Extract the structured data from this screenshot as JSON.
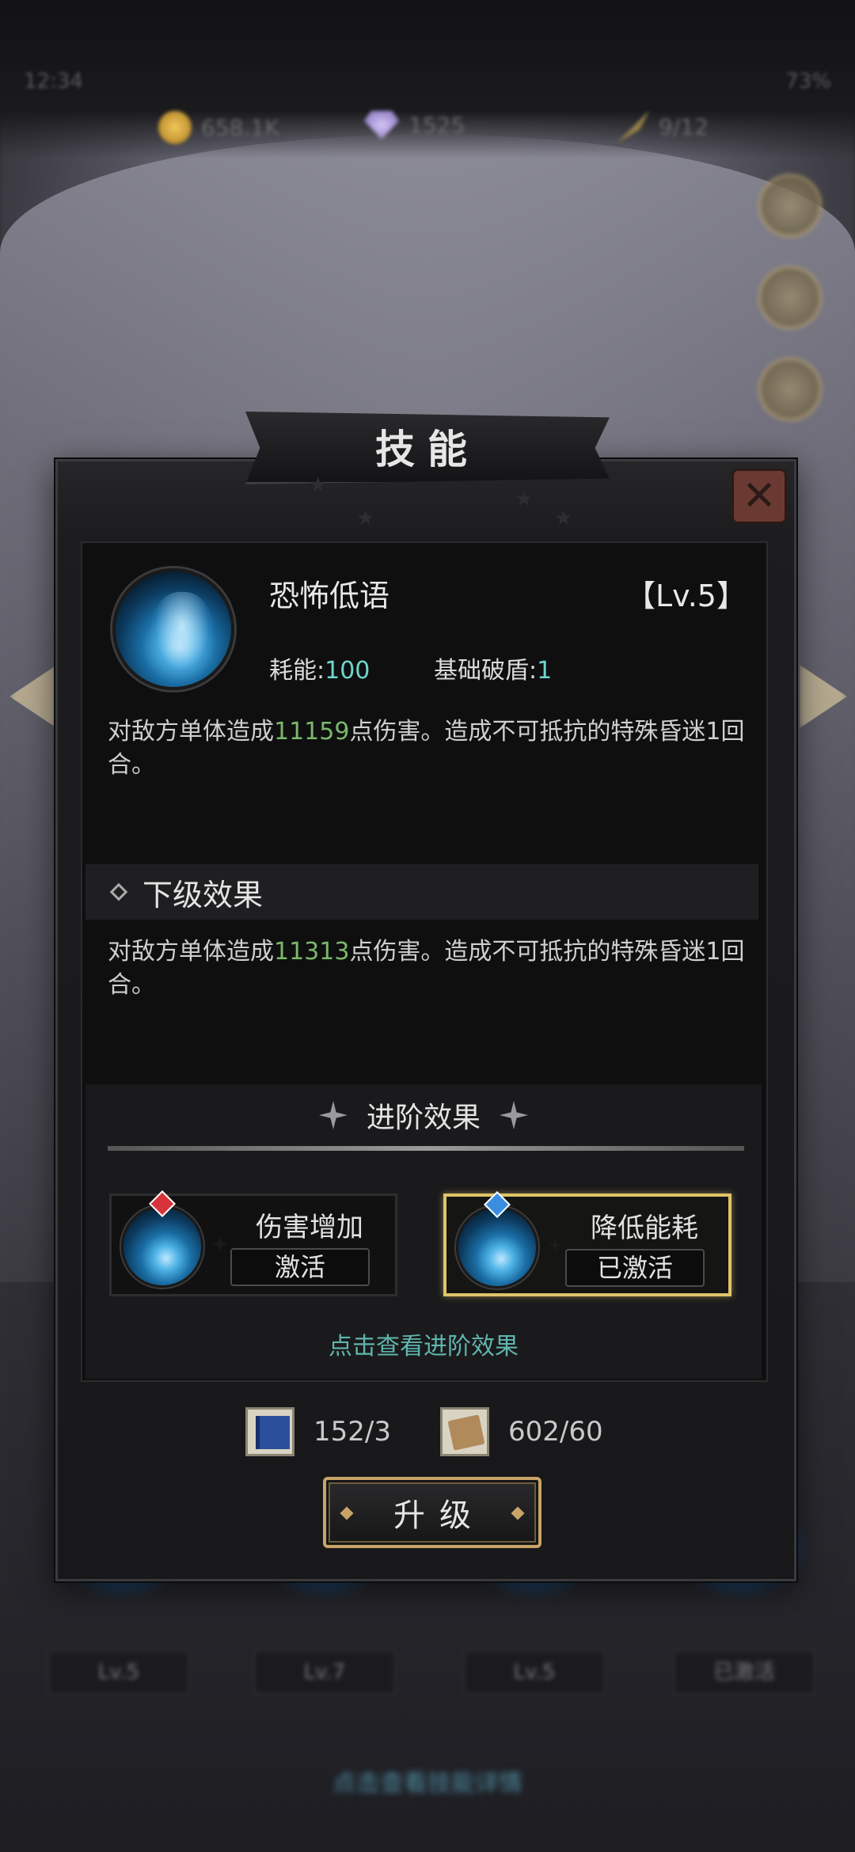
{
  "background": {
    "status_left": "12:34",
    "status_right": "73%",
    "resources": [
      {
        "icon": "coin-icon",
        "value": "658.1K"
      },
      {
        "icon": "gem-icon",
        "value": "1525"
      },
      {
        "icon": "feather-icon",
        "value": "9/12"
      }
    ],
    "bottom_pills": [
      "Lv.5",
      "Lv.7",
      "Lv.5",
      "已激活"
    ],
    "bottom_link": "点击查看技能详情"
  },
  "dialog": {
    "title": "技能",
    "skill": {
      "name": "恐怖低语",
      "level": "【Lv.5】",
      "cost_label": "耗能:",
      "cost_value": "100",
      "shield_label": "基础破盾:",
      "shield_value": "1",
      "desc_pre": "对敌方单体造成",
      "desc_num": "11159",
      "desc_post": "点伤害。造成不可抵抗的特殊昏迷1回合。"
    },
    "next_level": {
      "title": "下级效果",
      "desc_pre": "对敌方单体造成",
      "desc_num": "11313",
      "desc_post": "点伤害。造成不可抵抗的特殊昏迷1回合。"
    },
    "advanced": {
      "title": "进阶效果",
      "options": [
        {
          "name": "伤害增加",
          "button": "激活",
          "gem": "red",
          "active": false
        },
        {
          "name": "降低能耗",
          "button": "已激活",
          "gem": "blue",
          "active": true
        }
      ],
      "view_link": "点击查看进阶效果"
    },
    "costs": [
      {
        "icon": "skill-book-icon",
        "value": "152/3"
      },
      {
        "icon": "scroll-icon",
        "value": "602/60"
      }
    ],
    "upgrade_label": "升级"
  },
  "colors": {
    "highlight_number": "#7ab86b",
    "stat_value": "#6fd6cc",
    "link": "#5fb5ad",
    "active_border": "#e0c36a",
    "close_button": "#6a3a32"
  }
}
